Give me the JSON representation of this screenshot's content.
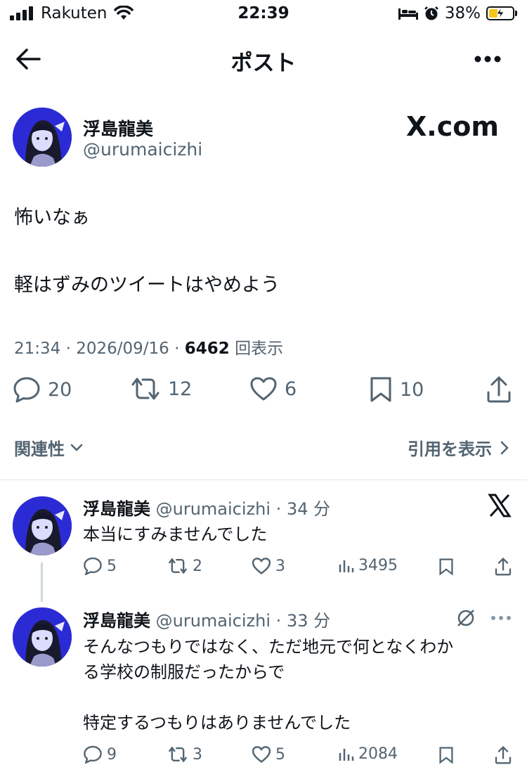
{
  "status_bar": {
    "carrier": "Rakuten",
    "time": "22:39",
    "battery": "38%",
    "battery_level": 0.38,
    "icons": [
      "signal-icon",
      "wifi-icon",
      "bed-icon",
      "alarm-icon",
      "battery-icon",
      "charging-icon"
    ]
  },
  "nav": {
    "title": "ポスト",
    "icons": [
      "back-arrow-icon",
      "more-icon"
    ]
  },
  "post": {
    "author_name": "浮島龍美",
    "author_handle": "@urumaicizhi",
    "watermark": "X.com",
    "line1": "怖いなぁ",
    "line2": "軽はずみのツイートはやめよう",
    "time": "21:34",
    "date": "2026/09/16",
    "views": "6462",
    "views_label": "回表示",
    "replies": "20",
    "reposts": "12",
    "likes": "6",
    "bookmarks": "10",
    "related_label": "関連性",
    "quotes_label": "引用を表示"
  },
  "replies": [
    {
      "name": "浮島龍美",
      "handle": "@urumaicizhi",
      "age": "34 分",
      "text": "本当にすみませんでした",
      "replies": "5",
      "reposts": "2",
      "likes": "3",
      "views": "3495"
    },
    {
      "name": "浮島龍美",
      "handle": "@urumaicizhi",
      "age": "33 分",
      "text_line1": "そんなつもりではなく、ただ地元で何となくわか",
      "text_line2": "る学校の制服だったからで",
      "text_line3": "特定するつもりはありませんでした",
      "replies": "9",
      "reposts": "3",
      "likes": "5",
      "views": "2084"
    }
  ],
  "colors": {
    "text": "#0f1419",
    "secondary": "#536471",
    "avatar_bg": "#2b2bd6",
    "battery_fill": "#f5c518"
  }
}
